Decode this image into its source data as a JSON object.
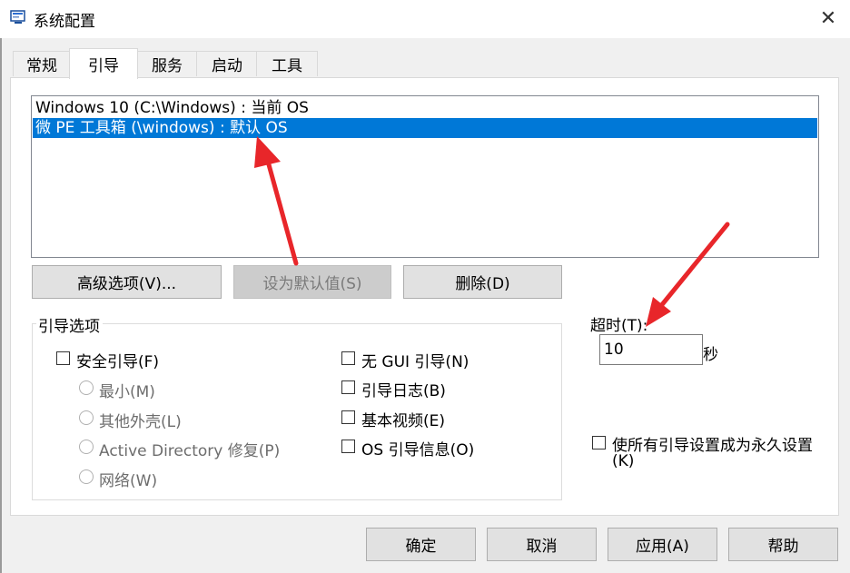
{
  "window": {
    "title": "系统配置",
    "icon": "msconfig-icon",
    "close_glyph": "✕"
  },
  "tabs": [
    {
      "label": "常规",
      "active": false
    },
    {
      "label": "引导",
      "active": true
    },
    {
      "label": "服务",
      "active": false
    },
    {
      "label": "启动",
      "active": false
    },
    {
      "label": "工具",
      "active": false
    }
  ],
  "os_list": [
    {
      "label": "Windows 10 (C:\\Windows) : 当前 OS",
      "selected": false
    },
    {
      "label": "微 PE 工具箱 (\\windows) : 默认 OS",
      "selected": true
    }
  ],
  "os_buttons": {
    "advanced": "高级选项(V)...",
    "set_default": "设为默认值(S)",
    "delete": "删除(D)"
  },
  "boot_options": {
    "group_label": "引导选项",
    "safe_boot": "安全引导(F)",
    "minimal": "最小(M)",
    "alternate_shell": "其他外壳(L)",
    "active_directory": "Active Directory 修复(P)",
    "network": "网络(W)",
    "no_gui": "无 GUI 引导(N)",
    "boot_log": "引导日志(B)",
    "base_video": "基本视频(E)",
    "os_boot_info": "OS 引导信息(O)"
  },
  "timeout": {
    "label": "超时(T):",
    "value": "10",
    "unit": "秒"
  },
  "permanent": {
    "label_line1": "使所有引导设置成为永久设置",
    "label_line2": "(K)"
  },
  "footer_buttons": {
    "ok": "确定",
    "cancel": "取消",
    "apply": "应用(A)",
    "help": "帮助"
  },
  "colors": {
    "selection": "#0078d7",
    "annotation_arrow": "#e8262a",
    "button_face": "#e1e1e1"
  }
}
